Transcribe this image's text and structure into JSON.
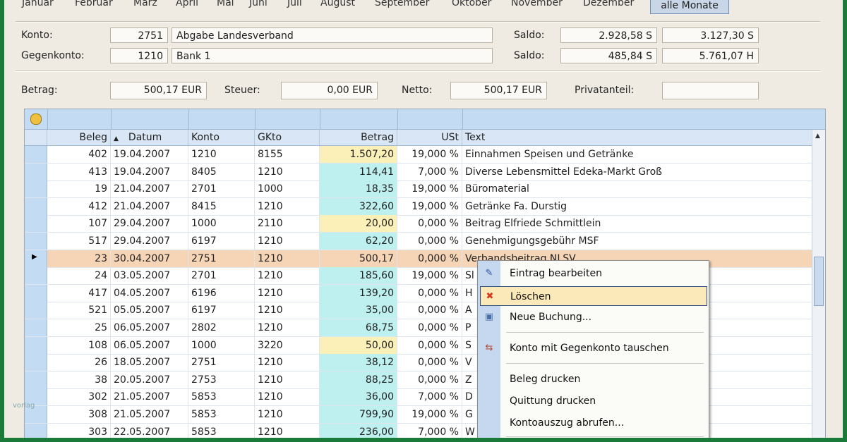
{
  "months": [
    "Januar",
    "Februar",
    "März",
    "April",
    "Mai",
    "Juni",
    "Juli",
    "August",
    "September",
    "Oktober",
    "November",
    "Dezember"
  ],
  "all_months_label": "alle Monate",
  "konto": {
    "label": "Konto:",
    "number": "2751",
    "name": "Abgabe Landesverband",
    "saldo_label": "Saldo:",
    "saldo1": "2.928,58 S",
    "saldo2": "3.127,30 S"
  },
  "gegenkonto": {
    "label": "Gegenkonto:",
    "number": "1210",
    "name": "Bank 1",
    "saldo_label": "Saldo:",
    "saldo1": "485,84 S",
    "saldo2": "5.761,07 H"
  },
  "amounts": {
    "betrag_label": "Betrag:",
    "betrag": "500,17 EUR",
    "steuer_label": "Steuer:",
    "steuer": "0,00 EUR",
    "netto_label": "Netto:",
    "netto": "500,17 EUR",
    "privat_label": "Privatanteil:",
    "privat": ""
  },
  "columns": [
    "Beleg",
    "Datum",
    "Konto",
    "GKto",
    "Betrag",
    "USt",
    "Text"
  ],
  "rows": [
    {
      "beleg": "402",
      "datum": "19.04.2007",
      "konto": "1210",
      "gkto": "8155",
      "betrag": "1.507,20",
      "ust": "19,000 %",
      "text": "Einnahmen Speisen und Getränke",
      "hl": "yellow"
    },
    {
      "beleg": "413",
      "datum": "19.04.2007",
      "konto": "8405",
      "gkto": "1210",
      "betrag": "114,41",
      "ust": "7,000 %",
      "text": "Diverse Lebensmittel Edeka-Markt Groß",
      "hl": "cyan"
    },
    {
      "beleg": "19",
      "datum": "21.04.2007",
      "konto": "2701",
      "gkto": "1000",
      "betrag": "18,35",
      "ust": "19,000 %",
      "text": "Büromaterial",
      "hl": "cyan"
    },
    {
      "beleg": "412",
      "datum": "21.04.2007",
      "konto": "8415",
      "gkto": "1210",
      "betrag": "322,60",
      "ust": "19,000 %",
      "text": "Getränke Fa. Durstig",
      "hl": "cyan"
    },
    {
      "beleg": "107",
      "datum": "29.04.2007",
      "konto": "1000",
      "gkto": "2110",
      "betrag": "20,00",
      "ust": "0,000 %",
      "text": "Beitrag Elfriede Schmittlein",
      "hl": "yellow"
    },
    {
      "beleg": "517",
      "datum": "29.04.2007",
      "konto": "6197",
      "gkto": "1210",
      "betrag": "62,20",
      "ust": "0,000 %",
      "text": "Genehmigungsgebühr MSF",
      "hl": "cyan"
    },
    {
      "beleg": "23",
      "datum": "30.04.2007",
      "konto": "2751",
      "gkto": "1210",
      "betrag": "500,17",
      "ust": "0,000 %",
      "text": "Verbandsbeitrag NLSV",
      "hl": "sel"
    },
    {
      "beleg": "24",
      "datum": "03.05.2007",
      "konto": "2701",
      "gkto": "1210",
      "betrag": "185,60",
      "ust": "19,000 %",
      "text": "Sl",
      "hl": "cyan"
    },
    {
      "beleg": "417",
      "datum": "04.05.2007",
      "konto": "6196",
      "gkto": "1210",
      "betrag": "139,20",
      "ust": "0,000 %",
      "text": "H",
      "hl": "cyan"
    },
    {
      "beleg": "521",
      "datum": "05.05.2007",
      "konto": "6197",
      "gkto": "1210",
      "betrag": "35,00",
      "ust": "0,000 %",
      "text": "A",
      "hl": "cyan"
    },
    {
      "beleg": "25",
      "datum": "06.05.2007",
      "konto": "2802",
      "gkto": "1210",
      "betrag": "68,75",
      "ust": "0,000 %",
      "text": "P",
      "hl": "cyan"
    },
    {
      "beleg": "108",
      "datum": "06.05.2007",
      "konto": "1000",
      "gkto": "3220",
      "betrag": "50,00",
      "ust": "0,000 %",
      "text": "S",
      "hl": "yellow"
    },
    {
      "beleg": "26",
      "datum": "18.05.2007",
      "konto": "2751",
      "gkto": "1210",
      "betrag": "38,12",
      "ust": "0,000 %",
      "text": "V",
      "hl": "cyan"
    },
    {
      "beleg": "38",
      "datum": "20.05.2007",
      "konto": "2753",
      "gkto": "1210",
      "betrag": "88,25",
      "ust": "0,000 %",
      "text": "Z",
      "hl": "cyan"
    },
    {
      "beleg": "302",
      "datum": "21.05.2007",
      "konto": "5853",
      "gkto": "1210",
      "betrag": "36,00",
      "ust": "7,000 %",
      "text": "D",
      "hl": "cyan"
    },
    {
      "beleg": "308",
      "datum": "21.05.2007",
      "konto": "5853",
      "gkto": "1210",
      "betrag": "799,90",
      "ust": "19,000 %",
      "text": "G",
      "hl": "cyan"
    },
    {
      "beleg": "303",
      "datum": "22.05.2007",
      "konto": "5853",
      "gkto": "1210",
      "betrag": "236,00",
      "ust": "7,000 %",
      "text": "W",
      "hl": "cyan"
    }
  ],
  "context_menu": [
    {
      "label": "Eintrag bearbeiten",
      "icon": "edit-icon"
    },
    {
      "label": "Löschen",
      "icon": "delete-icon"
    },
    {
      "label": "Neue Buchung...",
      "icon": "new-booking-icon"
    },
    {
      "label": "Konto mit Gegenkonto tauschen",
      "icon": "swap-icon"
    },
    {
      "label": "Beleg drucken",
      "icon": ""
    },
    {
      "label": "Quittung drucken",
      "icon": ""
    },
    {
      "label": "Kontoauszug abrufen...",
      "icon": ""
    }
  ],
  "watermark": "vorlag",
  "colors": {
    "yellow": "#fbf1b8",
    "cyan": "#bff0f0",
    "selected_row": "#f6d4b6",
    "menu_highlight": "#fbe9b9"
  }
}
